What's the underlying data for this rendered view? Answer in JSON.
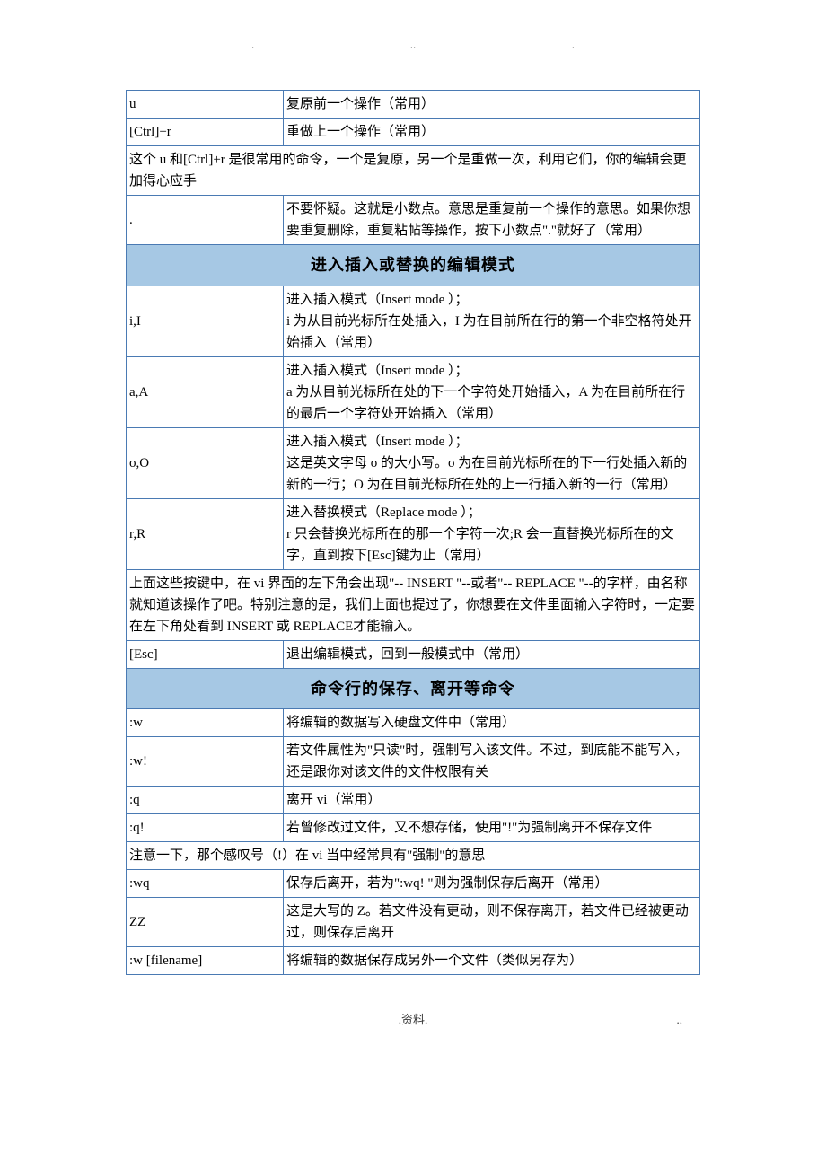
{
  "header": {
    "dot": ".",
    "doubledot": ".."
  },
  "rows1": [
    {
      "key": "u",
      "desc": "复原前一个操作（常用）"
    },
    {
      "key": "[Ctrl]+r",
      "desc": "重做上一个操作（常用）"
    }
  ],
  "note1": "这个 u 和[Ctrl]+r  是很常用的命令，一个是复原，另一个是重做一次，利用它们，你的编辑会更加得心应手",
  "row_dot": {
    "key": ".",
    "desc": "不要怀疑。这就是小数点。意思是重复前一个操作的意思。如果你想要重复删除，重复粘帖等操作，按下小数点\".\"就好了（常用）"
  },
  "section1": "进入插入或替换的编辑模式",
  "rows2": [
    {
      "key": "i,I",
      "desc": "进入插入模式（Insert mode ）；\ni 为从目前光标所在处插入，I 为在目前所在行的第一个非空格符处开始插入（常用）"
    },
    {
      "key": "a,A",
      "desc": "进入插入模式（Insert mode ）；\na 为从目前光标所在处的下一个字符处开始插入，A 为在目前所在行的最后一个字符处开始插入（常用）"
    },
    {
      "key": "o,O",
      "desc": "进入插入模式（Insert mode ）；\n这是英文字母 o 的大小写。o 为在目前光标所在的下一行处插入新的新的一行；O 为在目前光标所在处的上一行插入新的一行（常用）"
    },
    {
      "key": "r,R",
      "desc": "进入替换模式（Replace mode  ）；\nr 只会替换光标所在的那一个字符一次;R 会一直替换光标所在的文字，直到按下[Esc]键为止（常用）"
    }
  ],
  "note2": "上面这些按键中，在 vi 界面的左下角会出现\"-- INSERT \"--或者\"-- REPLACE \"--的字样，由名称就知道该操作了吧。特别注意的是，我们上面也提过了，你想要在文件里面输入字符时，一定要在左下角处看到 INSERT 或 REPLACE才能输入。",
  "row_esc": {
    "key": "[Esc]",
    "desc": "退出编辑模式，回到一般模式中（常用）"
  },
  "section2": "命令行的保存、离开等命令",
  "rows3": [
    {
      "key": ":w",
      "desc": "将编辑的数据写入硬盘文件中（常用）"
    },
    {
      "key": ":w!",
      "desc": "若文件属性为\"只读\"时，强制写入该文件。不过，到底能不能写入，还是跟你对该文件的文件权限有关"
    },
    {
      "key": ":q",
      "desc": "离开 vi（常用）"
    },
    {
      "key": ":q!",
      "desc": "若曾修改过文件，又不想存储，使用\"!\"为强制离开不保存文件"
    }
  ],
  "note3": "注意一下，那个感叹号（!）在 vi 当中经常具有\"强制\"的意思",
  "rows4": [
    {
      "key": ":wq",
      "desc": "保存后离开，若为\":wq! \"则为强制保存后离开（常用）"
    },
    {
      "key": "ZZ",
      "desc": "这是大写的 Z。若文件没有更动，则不保存离开，若文件已经被更动过，则保存后离开"
    },
    {
      "key": ":w [filename]",
      "desc": "将编辑的数据保存成另外一个文件（类似另存为）"
    }
  ],
  "footer": {
    "left": ".",
    "center": ".资料.",
    "right": ".."
  }
}
